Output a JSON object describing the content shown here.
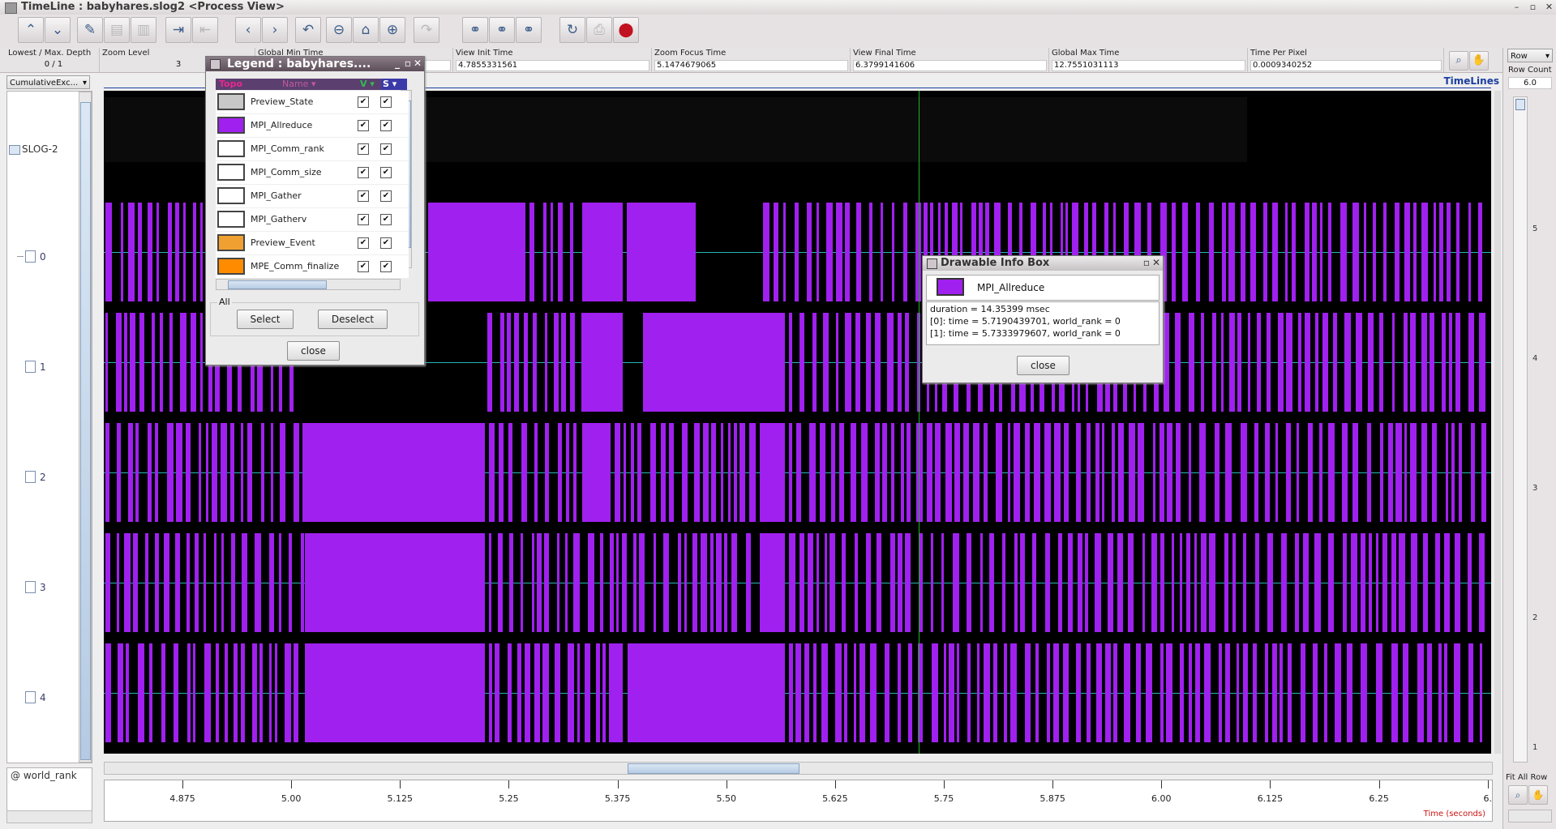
{
  "window": {
    "title": "TimeLine : babyhares.slog2 <Process View>"
  },
  "toolbar": {
    "icons": [
      "up-arrow-icon",
      "down-arrow-icon",
      "edit-icon",
      "copy-icon",
      "delete-icon",
      "export-icon",
      "import-icon",
      "scroll-left-icon",
      "scroll-right-icon",
      "undo-icon",
      "zoom-out-icon",
      "home-icon",
      "zoom-in-icon",
      "redo-icon",
      "search-backward-icon",
      "search-icon",
      "search-forward-icon",
      "refresh-icon",
      "print-icon",
      "stop-icon"
    ]
  },
  "info": {
    "lowest_label": "Lowest / Max. Depth",
    "lowest_value": "0 / 1",
    "zoom_label": "Zoom Level",
    "zoom_value": "3",
    "gmin_label": "Global Min Time",
    "gmin_value": "",
    "vinit_label": "View  Init Time",
    "vinit_value": "4.7855331561",
    "focus_label": "Zoom Focus Time",
    "focus_value": "5.1474679065",
    "vfinal_label": "View Final Time",
    "vfinal_value": "6.3799141606",
    "gmax_label": "Global Max Time",
    "gmax_value": "12.7551031113",
    "tpp_label": "Time Per Pixel",
    "tpp_value": "0.0009340252"
  },
  "left": {
    "combo": "CumulativeExc...",
    "root": "SLOG-2",
    "rows": [
      "0",
      "1",
      "2",
      "3",
      "4"
    ],
    "bottom_label": "@ world_rank"
  },
  "timeline": {
    "title": "TimeLines"
  },
  "axis": {
    "ticks": [
      "4.875",
      "5.00",
      "5.125",
      "5.25",
      "5.375",
      "5.50",
      "5.625",
      "5.75",
      "5.875",
      "6.00",
      "6.125",
      "6.25",
      "6."
    ],
    "label": "Time (seconds)"
  },
  "right": {
    "row_combo": "Row",
    "row_count_label": "Row Count",
    "row_count_value": "6.0",
    "ruler": [
      "5",
      "4",
      "3",
      "2",
      "1"
    ],
    "fit_label": "Fit All Row"
  },
  "legend": {
    "title": "Legend : babyhares....",
    "col_topo": "Topo",
    "col_name": "Name",
    "col_v": "V",
    "col_s": "S",
    "items": [
      {
        "name": "Preview_State",
        "color": "#c8c8c8"
      },
      {
        "name": "MPI_Allreduce",
        "color": "#a020f0"
      },
      {
        "name": "MPI_Comm_rank",
        "color": "#ffffff"
      },
      {
        "name": "MPI_Comm_size",
        "color": "#ffffff"
      },
      {
        "name": "MPI_Gather",
        "color": "#ffffff"
      },
      {
        "name": "MPI_Gatherv",
        "color": "#ffffff"
      },
      {
        "name": "Preview_Event",
        "color": "#f0a030"
      },
      {
        "name": "MPE_Comm_finalize",
        "color": "#ff8c00"
      }
    ],
    "all_label": "All",
    "select": "Select",
    "deselect": "Deselect",
    "close": "close"
  },
  "infobox": {
    "title": "Drawable Info Box",
    "name": "MPI_Allreduce",
    "line1": "duration = 14.35399 msec",
    "line2": "[0]: time = 5.7190439701, world_rank = 0",
    "line3": "[1]: time = 5.7333979607, world_rank = 0",
    "close": "close"
  },
  "colors": {
    "state": "#a020f0",
    "timeline_bg": "#000000",
    "rank_line": "#26b5b5",
    "focus_line": "#1db51d"
  }
}
